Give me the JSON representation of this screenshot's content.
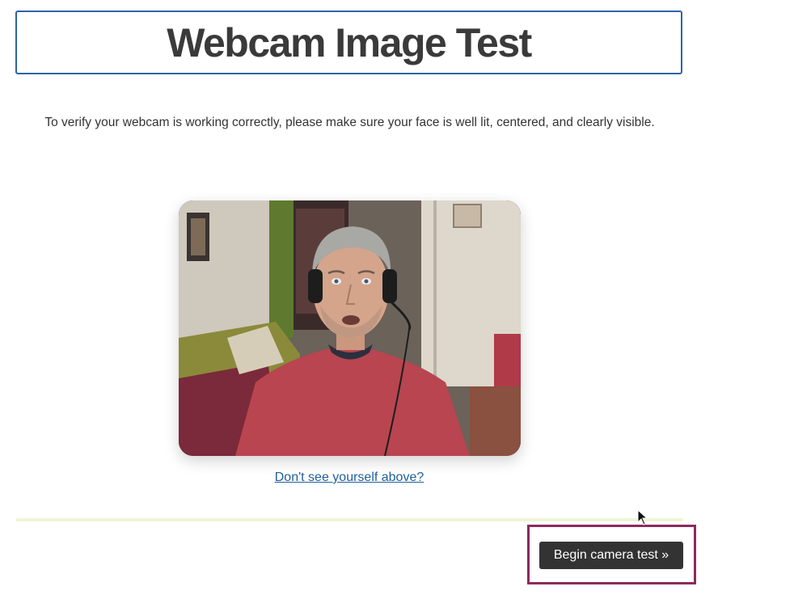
{
  "header": {
    "title": "Webcam Image Test"
  },
  "instructions": {
    "text": "To verify your webcam is working correctly, please make sure your face is well lit, centered, and clearly visible."
  },
  "video": {
    "content": "webcam-preview"
  },
  "help_link": {
    "label": "Don't see yourself above?"
  },
  "actions": {
    "begin_label": "Begin camera test »"
  },
  "colors": {
    "title_border": "#2f63a8",
    "button_bg": "#333333",
    "highlight": "#8c2a5e",
    "link": "#1f5f9c",
    "divider": "#eef5d8"
  },
  "icons": {
    "cursor": "mouse-pointer-icon"
  }
}
